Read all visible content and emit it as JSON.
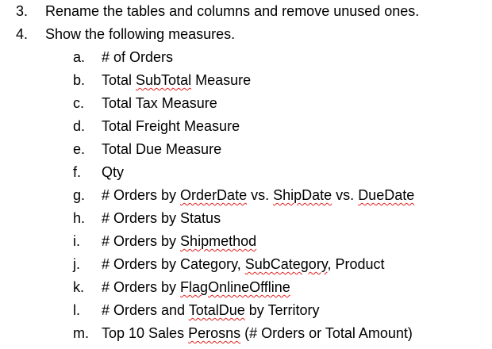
{
  "document": {
    "main_items": [
      {
        "num": "3.",
        "text": "Rename the tables and columns and remove unused ones."
      },
      {
        "num": "4.",
        "text": "Show the following measures."
      }
    ],
    "sub_items": [
      {
        "num": "a.",
        "parts": [
          {
            "t": "# of Orders",
            "s": false
          }
        ]
      },
      {
        "num": "b.",
        "parts": [
          {
            "t": "Total ",
            "s": false
          },
          {
            "t": "SubTotal",
            "s": true
          },
          {
            "t": " Measure",
            "s": false
          }
        ]
      },
      {
        "num": "c.",
        "parts": [
          {
            "t": "Total Tax Measure",
            "s": false
          }
        ]
      },
      {
        "num": "d.",
        "parts": [
          {
            "t": "Total Freight  Measure",
            "s": false
          }
        ]
      },
      {
        "num": "e.",
        "parts": [
          {
            "t": "Total Due Measure",
            "s": false
          }
        ]
      },
      {
        "num": "f.",
        "parts": [
          {
            "t": "Qty",
            "s": false
          }
        ]
      },
      {
        "num": "g.",
        "parts": [
          {
            "t": "# Orders by ",
            "s": false
          },
          {
            "t": "OrderDate",
            "s": true
          },
          {
            "t": " vs. ",
            "s": false
          },
          {
            "t": "ShipDate",
            "s": true
          },
          {
            "t": " vs. ",
            "s": false
          },
          {
            "t": "DueDate",
            "s": true
          }
        ]
      },
      {
        "num": "h.",
        "parts": [
          {
            "t": "# Orders by Status",
            "s": false
          }
        ]
      },
      {
        "num": "i.",
        "parts": [
          {
            "t": "# Orders by ",
            "s": false
          },
          {
            "t": "Shipmethod",
            "s": true
          }
        ]
      },
      {
        "num": "j.",
        "parts": [
          {
            "t": "# Orders by Category, ",
            "s": false
          },
          {
            "t": "SubCategory",
            "s": true
          },
          {
            "t": ", Product",
            "s": false
          }
        ]
      },
      {
        "num": "k.",
        "parts": [
          {
            "t": "# Orders by ",
            "s": false
          },
          {
            "t": "FlagOnlineOffline",
            "s": true
          }
        ]
      },
      {
        "num": "l.",
        "parts": [
          {
            "t": "# Orders and ",
            "s": false
          },
          {
            "t": "TotalDue",
            "s": true
          },
          {
            "t": " by Territory",
            "s": false
          }
        ]
      },
      {
        "num": "m.",
        "parts": [
          {
            "t": "Top 10 Sales ",
            "s": false
          },
          {
            "t": "Perosns",
            "s": true
          },
          {
            "t": " (# Orders or Total Amount)",
            "s": false
          }
        ]
      }
    ]
  },
  "colors": {
    "text": "#000000",
    "spellcheck_underline": "#e02020",
    "background": "#ffffff"
  }
}
